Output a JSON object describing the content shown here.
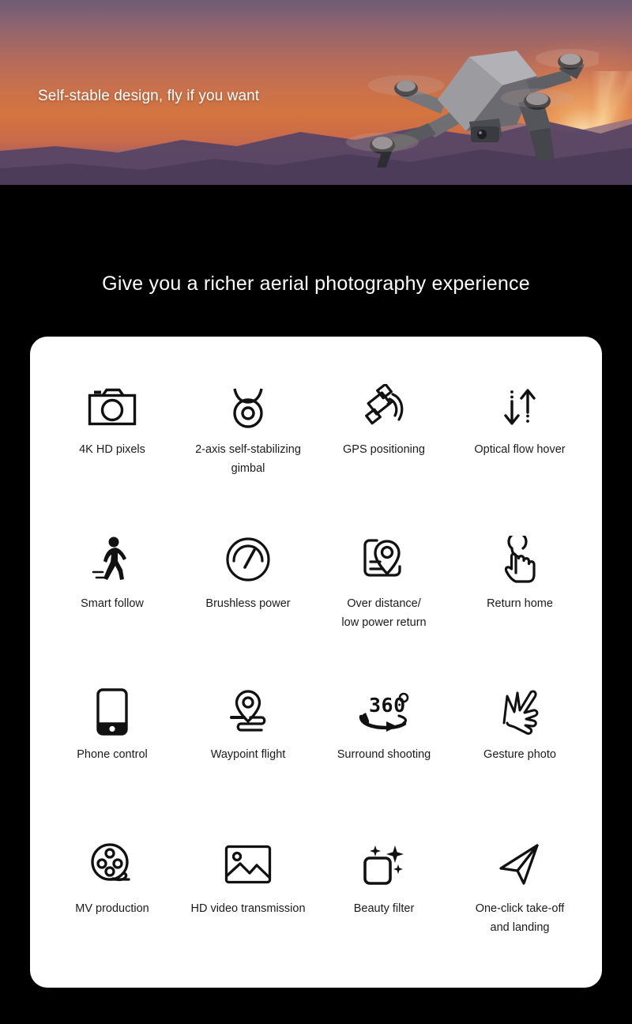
{
  "banner": {
    "tagline": "Self-stable design, fly if you want",
    "scene": "drone-sunset-mountains"
  },
  "headline": "Give you a richer aerial photography experience",
  "features": [
    {
      "icon": "camera-icon",
      "label": "4K HD pixels"
    },
    {
      "icon": "gimbal-icon",
      "label": "2-axis self-stabilizing gimbal"
    },
    {
      "icon": "satellite-icon",
      "label": "GPS positioning"
    },
    {
      "icon": "optical-flow-icon",
      "label": "Optical flow hover"
    },
    {
      "icon": "walking-person-icon",
      "label": "Smart follow"
    },
    {
      "icon": "gauge-icon",
      "label": "Brushless power"
    },
    {
      "icon": "map-pin-icon",
      "label": "Over distance/\nlow power return"
    },
    {
      "icon": "tap-hand-icon",
      "label": "Return home"
    },
    {
      "icon": "smartphone-icon",
      "label": "Phone control"
    },
    {
      "icon": "waypoint-icon",
      "label": "Waypoint flight"
    },
    {
      "icon": "360-rotate-icon",
      "label": "Surround shooting"
    },
    {
      "icon": "gesture-hand-icon",
      "label": "Gesture photo"
    },
    {
      "icon": "film-reel-icon",
      "label": "MV production"
    },
    {
      "icon": "photo-icon",
      "label": "HD video transmission"
    },
    {
      "icon": "sparkle-square-icon",
      "label": "Beauty filter"
    },
    {
      "icon": "paper-plane-icon",
      "label": "One-click take-off\nand landing"
    }
  ],
  "colors": {
    "page_background": "#000000",
    "card_background": "#ffffff",
    "icon_stroke": "#111111",
    "text_primary": "#1b1b1b",
    "text_on_dark": "#ffffff",
    "sky_top": "#6e5b74",
    "sky_mid": "#d4743f",
    "sun_glow": "#ffecbe",
    "ridge_far": "#8a6a7d",
    "ridge_near": "#5d4a68"
  }
}
